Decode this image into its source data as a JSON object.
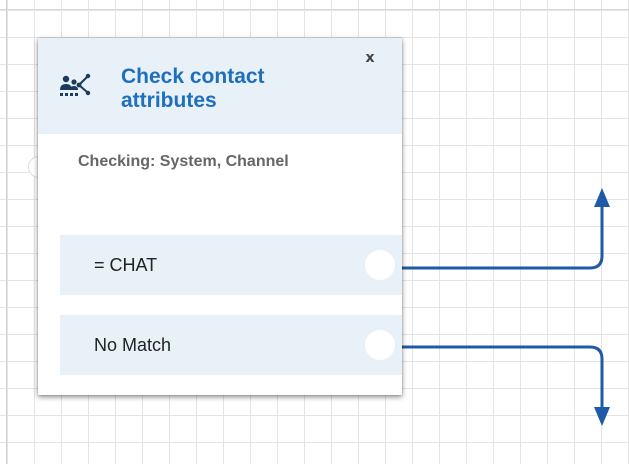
{
  "block": {
    "title": "Check contact attributes",
    "close_label": "x",
    "description": "Checking: System, Channel",
    "icon": "check-contact-attributes-icon"
  },
  "branches": [
    {
      "label": "= CHAT"
    },
    {
      "label": "No Match"
    }
  ],
  "colors": {
    "title": "#1f6fbf",
    "header_bg": "#e8f0f8",
    "connector": "#1e5aa8"
  }
}
